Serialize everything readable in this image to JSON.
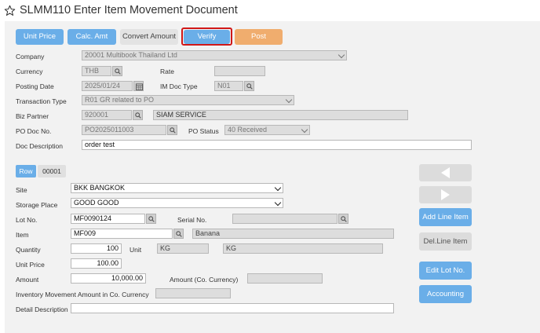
{
  "window": {
    "title": "SLMM110 Enter Item Movement Document"
  },
  "toolbar": {
    "unit_price": "Unit Price",
    "calc_amt": "Calc. Amt",
    "convert_amount": "Convert Amount",
    "verify": "Verify",
    "post": "Post"
  },
  "header_form": {
    "company": {
      "label": "Company",
      "value": "20001 Multibook Thailand Ltd"
    },
    "currency": {
      "label": "Currency",
      "value": "THB"
    },
    "rate": {
      "label": "Rate",
      "value": ""
    },
    "posting_date": {
      "label": "Posting Date",
      "value": "2025/01/24"
    },
    "im_doc_type": {
      "label": "IM Doc Type",
      "value": "N01"
    },
    "transaction_type": {
      "label": "Transaction Type",
      "value": "R01 GR related to PO"
    },
    "biz_partner": {
      "label": "Biz Partner",
      "code": "920001",
      "name": "SIAM SERVICE"
    },
    "po_doc_no": {
      "label": "PO Doc No.",
      "value": "PO2025011003"
    },
    "po_status": {
      "label": "PO Status",
      "value": "40 Received"
    },
    "doc_description": {
      "label": "Doc Description",
      "value": "order test"
    }
  },
  "line_tabs": {
    "row_label": "Row",
    "row_number": "00001"
  },
  "line_form": {
    "site": {
      "label": "Site",
      "value": "BKK BANGKOK"
    },
    "storage_place": {
      "label": "Storage Place",
      "value": "GOOD GOOD"
    },
    "lot_no": {
      "label": "Lot No.",
      "value": "MF0090124"
    },
    "serial_no": {
      "label": "Serial No.",
      "value": ""
    },
    "item": {
      "label": "Item",
      "code": "MF009",
      "name": "Banana"
    },
    "quantity": {
      "label": "Quantity",
      "value": "100"
    },
    "unit": {
      "label": "Unit",
      "code": "KG",
      "name": "KG"
    },
    "unit_price": {
      "label": "Unit Price",
      "value": "100.00"
    },
    "amount": {
      "label": "Amount",
      "value": "10,000.00"
    },
    "amount_co_currency": {
      "label": "Amount (Co. Currency)",
      "value": ""
    },
    "inv_movement_amount": {
      "label": "Inventory Movement Amount in Co. Currency",
      "value": ""
    },
    "detail_description": {
      "label": "Detail Description",
      "value": ""
    }
  },
  "side_actions": {
    "add_line_item": "Add Line Item",
    "del_line_item": "Del.Line Item",
    "edit_lot_no": "Edit Lot No.",
    "accounting": "Accounting"
  },
  "colors": {
    "primary_button": "#6aaee8",
    "post_button": "#f0ad6e",
    "disabled_button": "#e3e3e3",
    "highlight_outline": "#d01818",
    "panel_background": "#f2f2f2",
    "readonly_field": "#dddddd"
  },
  "icons": {
    "favorite": "star-icon",
    "lookup": "search-icon",
    "calendar": "calendar-icon",
    "prev": "arrow-left-icon",
    "next": "arrow-right-icon",
    "dropdown": "chevron-down-icon"
  }
}
